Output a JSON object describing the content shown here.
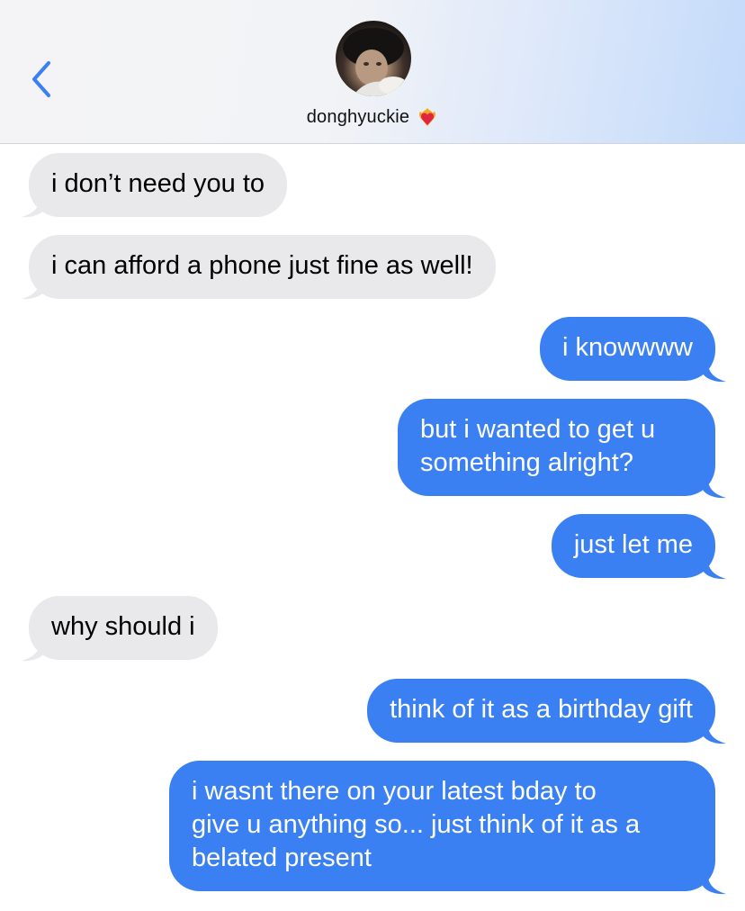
{
  "header": {
    "contact_name": "donghyuckie",
    "back_icon": "chevron-left-icon",
    "badge_icon": "heart-on-fire-emoji",
    "accent_color": "#3b80f2"
  },
  "messages": [
    {
      "side": "incoming",
      "text": "i don’t need you to"
    },
    {
      "side": "incoming",
      "text": "i can afford a phone just fine as well!"
    },
    {
      "side": "outgoing",
      "text": "i knowwww"
    },
    {
      "side": "outgoing",
      "lines": [
        "but i wanted to get u",
        "something alright?"
      ]
    },
    {
      "side": "outgoing",
      "text": "just let me"
    },
    {
      "side": "incoming",
      "text": "why should i"
    },
    {
      "side": "outgoing",
      "text": "think of it as a birthday gift"
    },
    {
      "side": "outgoing",
      "lines": [
        "i wasnt there on your latest bday to",
        "give u anything so... just think of it as a",
        "belated present"
      ]
    }
  ],
  "colors": {
    "incoming_bubble": "#e9e9eb",
    "outgoing_bubble": "#3b80f2"
  }
}
